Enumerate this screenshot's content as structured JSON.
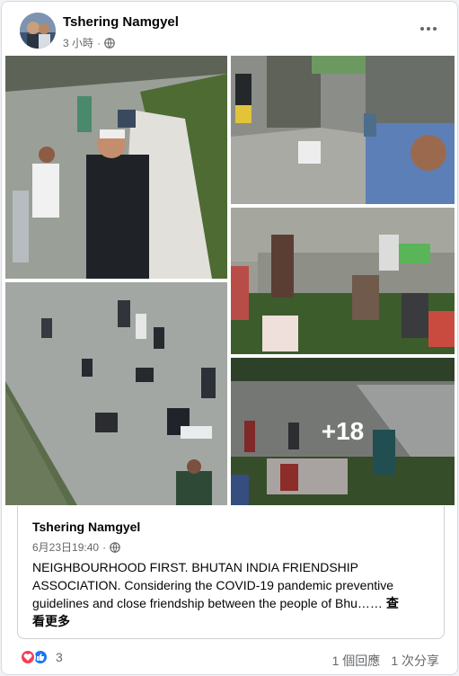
{
  "post": {
    "author": "Tshering Namgyel",
    "time": "3 小時",
    "audience_icon": "globe-icon",
    "more_icon": "more-options-icon"
  },
  "photos": {
    "more_count": "+18"
  },
  "shared_post": {
    "author": "Tshering Namgyel",
    "time": "6月23日19:40",
    "text": "NEIGHBOURHOOD FIRST. BHUTAN INDIA FRIENDSHIP ASSOCIATION. Considering the COVID-19 pandemic preventive guidelines and close friendship between the people of Bhu……",
    "see_more_part1": "查",
    "see_more_part2": "看更多"
  },
  "footer": {
    "reaction_count": "3",
    "comments": "1 個回應",
    "shares": "1 次分享"
  },
  "colors": {
    "like": "#1877f2",
    "love": "#f33e58",
    "meta": "#65676b"
  }
}
